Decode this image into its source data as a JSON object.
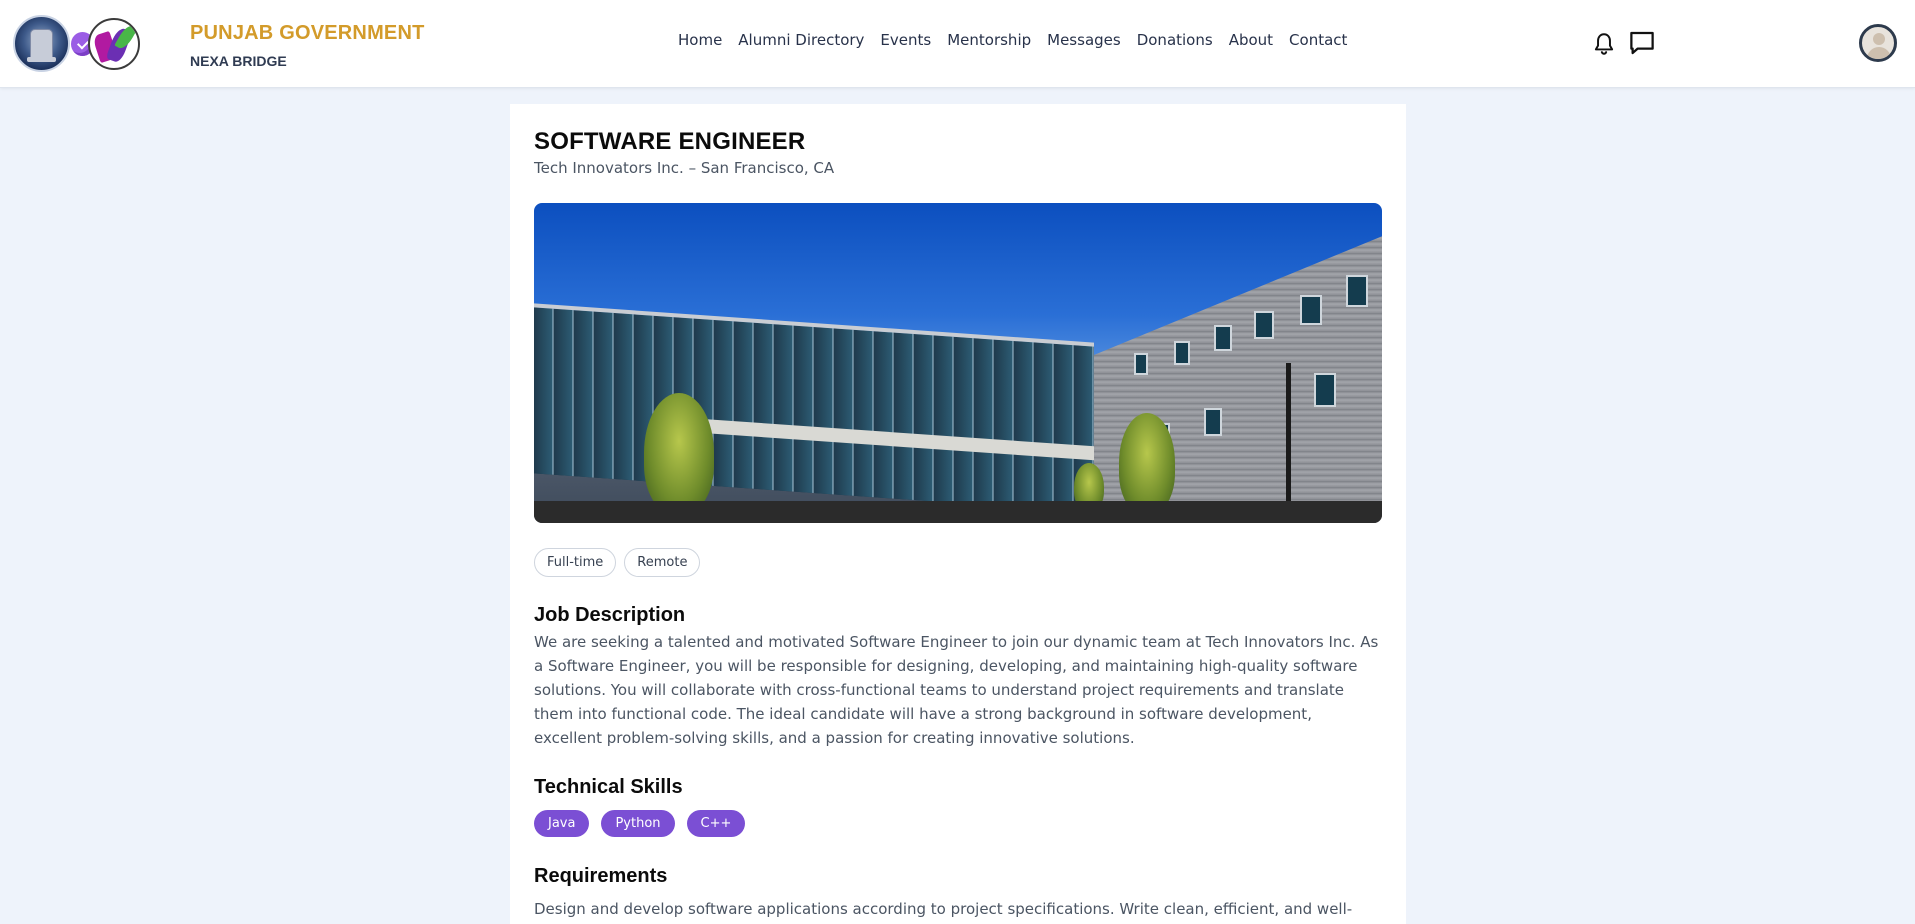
{
  "header": {
    "brand_title": "PUNJAB GOVERNMENT",
    "brand_subtitle": "NEXA BRIDGE",
    "nav": [
      "Home",
      "Alumni Directory",
      "Events",
      "Mentorship",
      "Messages",
      "Donations",
      "About",
      "Contact"
    ],
    "icons": [
      "bell-icon",
      "chat-icon",
      "avatar"
    ]
  },
  "job": {
    "title": "SOFTWARE ENGINEER",
    "company_location": "Tech Innovators Inc. – San Francisco, CA",
    "image_alt": "office-building-photo",
    "tags": [
      "Full-time",
      "Remote"
    ],
    "description_heading": "Job Description",
    "description": "We are seeking a talented and motivated Software Engineer to join our dynamic team at Tech Innovators Inc. As a Software Engineer, you will be responsible for designing, developing, and maintaining high-quality software solutions. You will collaborate with cross-functional teams to understand project requirements and translate them into functional code. The ideal candidate will have a strong background in software development, excellent problem-solving skills, and a passion for creating innovative solutions.",
    "skills_heading": "Technical Skills",
    "skills": [
      "Java",
      "Python",
      "C++"
    ],
    "requirements_heading": "Requirements",
    "requirements_preview": "Design and develop software applications according to project specifications. Write clean, efficient, and well-"
  },
  "colors": {
    "accent": "#7b4fd4",
    "brand_gold": "#d39b2a",
    "background": "#eef3fb"
  }
}
